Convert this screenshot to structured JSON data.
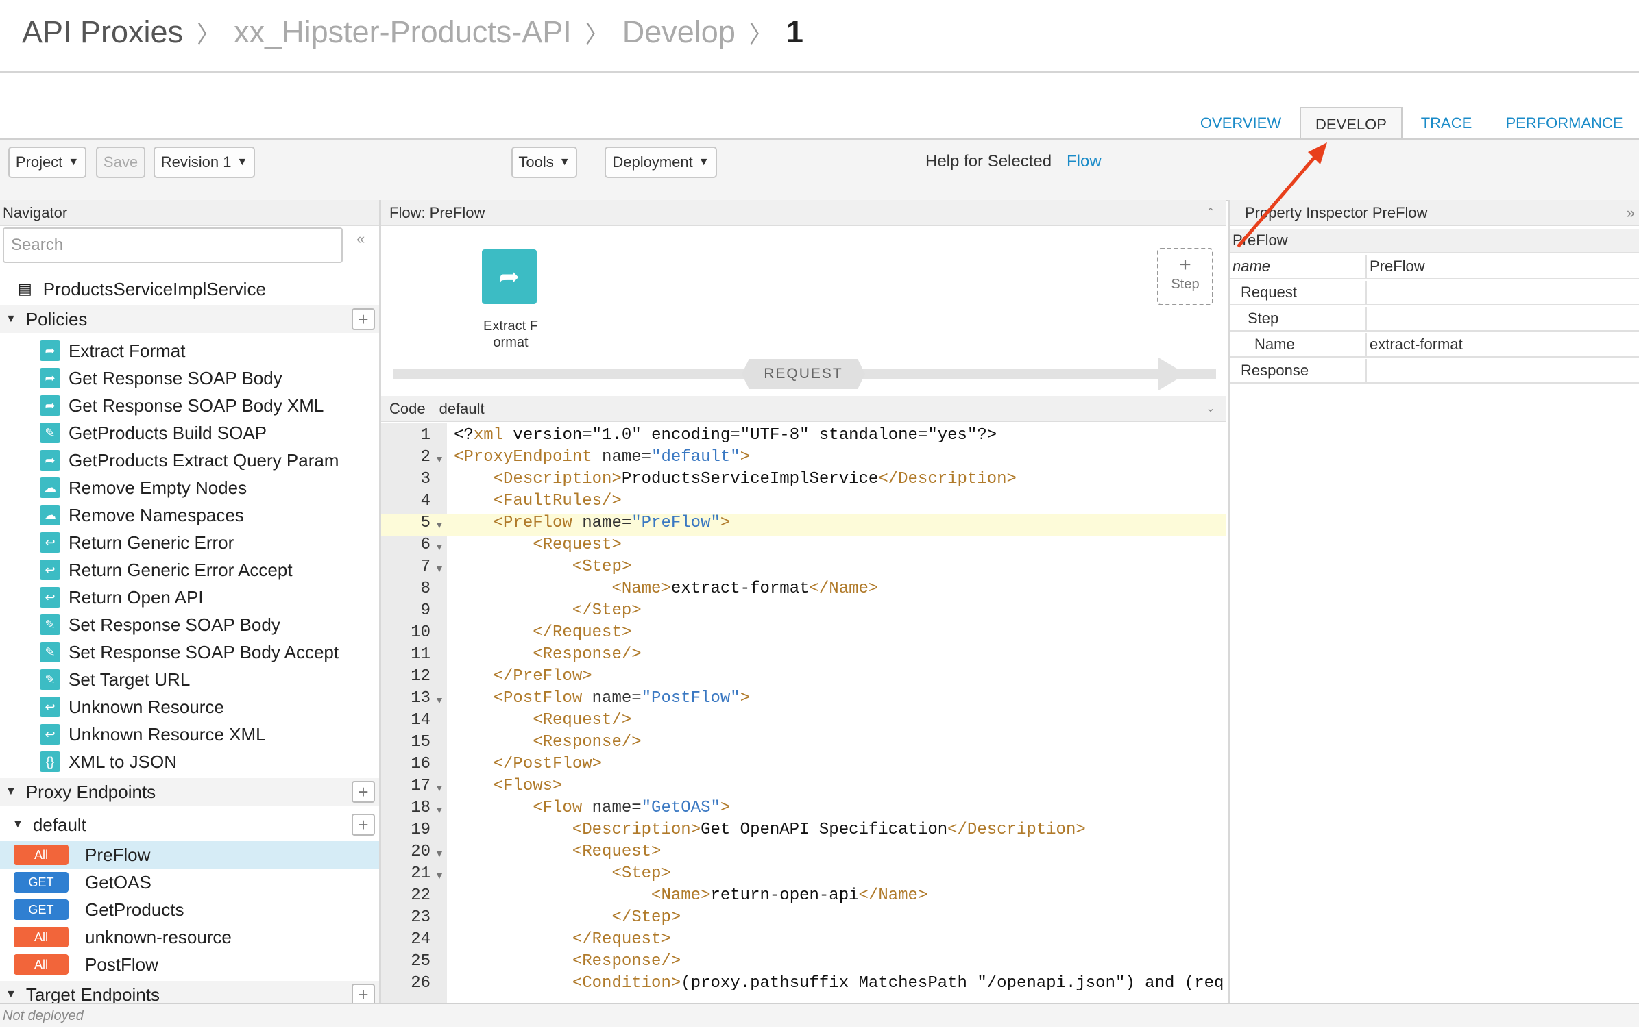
{
  "breadcrumb": {
    "root": "API Proxies",
    "proxy": "xx_Hipster-Products-API",
    "section": "Develop",
    "revision": "1"
  },
  "tabs": {
    "overview": "OVERVIEW",
    "develop": "DEVELOP",
    "trace": "TRACE",
    "performance": "PERFORMANCE"
  },
  "toolbar": {
    "project": "Project",
    "save": "Save",
    "revision": "Revision 1",
    "tools": "Tools",
    "deployment": "Deployment",
    "help_label": "Help for Selected",
    "help_link": "Flow"
  },
  "navigator": {
    "title": "Navigator",
    "search_placeholder": "Search",
    "service": "ProductsServiceImplService",
    "policies_label": "Policies",
    "policies": [
      "Extract Format",
      "Get Response SOAP Body",
      "Get Response SOAP Body XML",
      "GetProducts Build SOAP",
      "GetProducts Extract Query Param",
      "Remove Empty Nodes",
      "Remove Namespaces",
      "Return Generic Error",
      "Return Generic Error Accept",
      "Return Open API",
      "Set Response SOAP Body",
      "Set Response SOAP Body Accept",
      "Set Target URL",
      "Unknown Resource",
      "Unknown Resource XML",
      "XML to JSON"
    ],
    "proxy_endpoints_label": "Proxy Endpoints",
    "endpoint_name": "default",
    "flows": [
      {
        "method": "All",
        "name": "PreFlow"
      },
      {
        "method": "GET",
        "name": "GetOAS"
      },
      {
        "method": "GET",
        "name": "GetProducts"
      },
      {
        "method": "All",
        "name": "unknown-resource"
      },
      {
        "method": "All",
        "name": "PostFlow"
      }
    ],
    "target_endpoints_label": "Target Endpoints"
  },
  "flow_panel": {
    "title": "Flow: PreFlow",
    "policy_label": "Extract F ormat",
    "step_plus": "+",
    "step_label": "Step",
    "request_label": "REQUEST"
  },
  "code_panel": {
    "title": "Code",
    "file": "default"
  },
  "code_lines": [
    {
      "n": "1",
      "t": "<?xml version=\"1.0\" encoding=\"UTF-8\" standalone=\"yes\"?>"
    },
    {
      "n": "2",
      "t": "<ProxyEndpoint name=\"default\">"
    },
    {
      "n": "3",
      "t": "    <Description>ProductsServiceImplService</Description>"
    },
    {
      "n": "4",
      "t": "    <FaultRules/>"
    },
    {
      "n": "5",
      "t": "    <PreFlow name=\"PreFlow\">"
    },
    {
      "n": "6",
      "t": "        <Request>"
    },
    {
      "n": "7",
      "t": "            <Step>"
    },
    {
      "n": "8",
      "t": "                <Name>extract-format</Name>"
    },
    {
      "n": "9",
      "t": "            </Step>"
    },
    {
      "n": "10",
      "t": "        </Request>"
    },
    {
      "n": "11",
      "t": "        <Response/>"
    },
    {
      "n": "12",
      "t": "    </PreFlow>"
    },
    {
      "n": "13",
      "t": "    <PostFlow name=\"PostFlow\">"
    },
    {
      "n": "14",
      "t": "        <Request/>"
    },
    {
      "n": "15",
      "t": "        <Response/>"
    },
    {
      "n": "16",
      "t": "    </PostFlow>"
    },
    {
      "n": "17",
      "t": "    <Flows>"
    },
    {
      "n": "18",
      "t": "        <Flow name=\"GetOAS\">"
    },
    {
      "n": "19",
      "t": "            <Description>Get OpenAPI Specification</Description>"
    },
    {
      "n": "20",
      "t": "            <Request>"
    },
    {
      "n": "21",
      "t": "                <Step>"
    },
    {
      "n": "22",
      "t": "                    <Name>return-open-api</Name>"
    },
    {
      "n": "23",
      "t": "                </Step>"
    },
    {
      "n": "24",
      "t": "            </Request>"
    },
    {
      "n": "25",
      "t": "            <Response/>"
    },
    {
      "n": "26",
      "t": "            <Condition>(proxy.pathsuffix MatchesPath \"/openapi.json\") and (req"
    }
  ],
  "inspector": {
    "title": "Property Inspector  PreFlow",
    "rows": [
      {
        "key": "PreFlow",
        "value": ""
      },
      {
        "key": "name",
        "value": "PreFlow"
      },
      {
        "key": "Request",
        "value": ""
      },
      {
        "key": "Step",
        "value": ""
      },
      {
        "key": "Name",
        "value": "extract-format"
      },
      {
        "key": "Response",
        "value": ""
      }
    ]
  },
  "status": "Not deployed",
  "colors": {
    "accent": "#1a8bc8",
    "policy_teal": "#3cbcc4",
    "method_all": "#f2653a",
    "method_get": "#2f7fd1",
    "annotation": "#e8401c"
  }
}
